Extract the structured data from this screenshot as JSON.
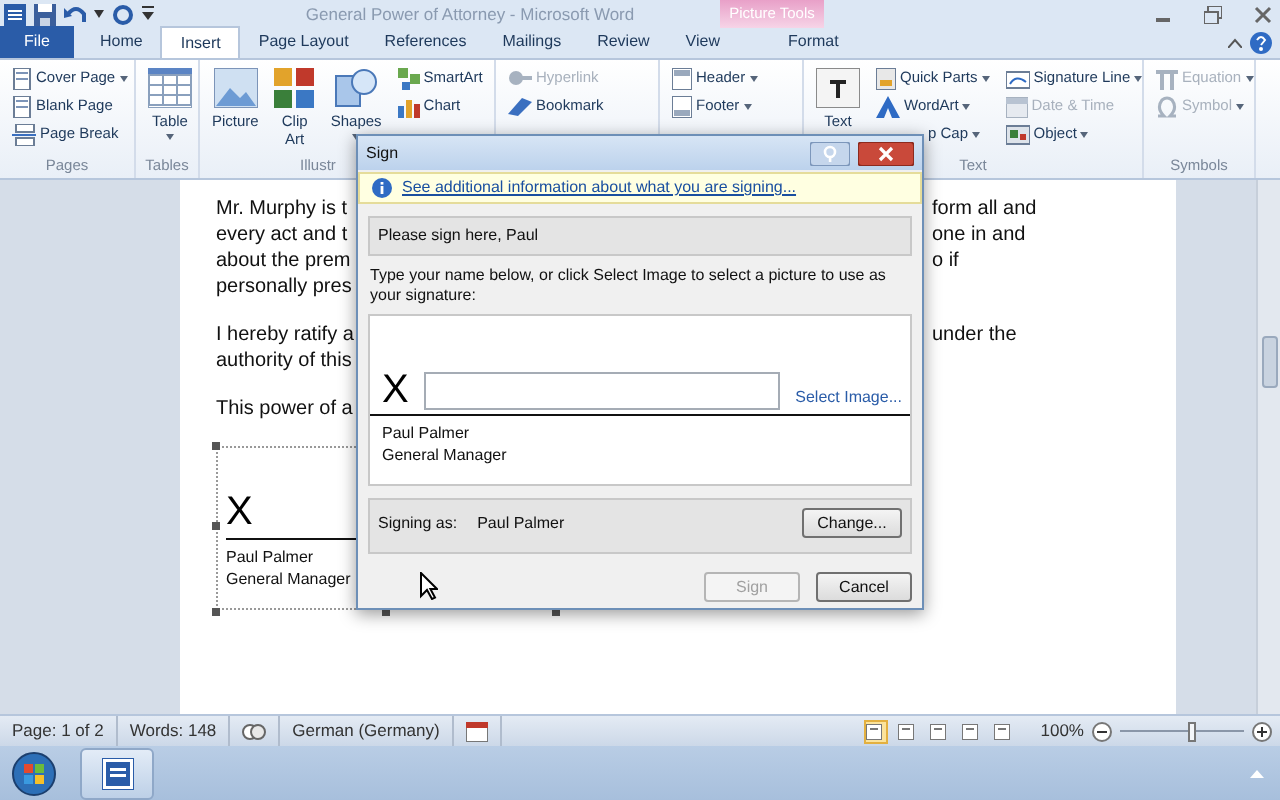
{
  "window": {
    "title": "General Power of Attorney - Microsoft Word",
    "contextual_tab": "Picture Tools"
  },
  "tabs": [
    {
      "label": "File",
      "kind": "file",
      "selected": false
    },
    {
      "label": "Home",
      "kind": "normal",
      "selected": false
    },
    {
      "label": "Insert",
      "kind": "normal",
      "selected": true
    },
    {
      "label": "Page Layout",
      "kind": "normal",
      "selected": false
    },
    {
      "label": "References",
      "kind": "normal",
      "selected": false
    },
    {
      "label": "Mailings",
      "kind": "normal",
      "selected": false
    },
    {
      "label": "Review",
      "kind": "normal",
      "selected": false
    },
    {
      "label": "View",
      "kind": "normal",
      "selected": false
    },
    {
      "label": "Format",
      "kind": "contextual",
      "selected": false
    }
  ],
  "ribbon": {
    "groups": [
      {
        "label": "Pages",
        "items": [
          {
            "label": "Cover Page",
            "kind": "small",
            "dropdown": true,
            "disabled": false
          },
          {
            "label": "Blank Page",
            "kind": "small",
            "dropdown": false,
            "disabled": false
          },
          {
            "label": "Page Break",
            "kind": "small",
            "dropdown": false,
            "disabled": false
          }
        ]
      },
      {
        "label": "Tables",
        "items": [
          {
            "label": "Table",
            "kind": "large",
            "dropdown": true,
            "disabled": false
          }
        ]
      },
      {
        "label": "Illustr",
        "items": [
          {
            "label": "Picture",
            "kind": "large",
            "dropdown": false,
            "disabled": false
          },
          {
            "label": "Clip Art",
            "kind": "large",
            "dropdown": false,
            "disabled": false
          },
          {
            "label": "Shapes",
            "kind": "large",
            "dropdown": true,
            "disabled": false
          },
          {
            "label": "SmartArt",
            "kind": "small",
            "dropdown": false,
            "disabled": false
          },
          {
            "label": "Chart",
            "kind": "small",
            "dropdown": false,
            "disabled": false
          }
        ]
      },
      {
        "items": [
          {
            "label": "Hyperlink",
            "kind": "small",
            "dropdown": false,
            "disabled": true
          },
          {
            "label": "Bookmark",
            "kind": "small",
            "dropdown": false,
            "disabled": false
          }
        ]
      },
      {
        "items": [
          {
            "label": "Header",
            "kind": "small",
            "dropdown": true,
            "disabled": false
          },
          {
            "label": "Footer",
            "kind": "small",
            "dropdown": true,
            "disabled": false
          }
        ]
      },
      {
        "label": "Text",
        "items": [
          {
            "label": "Text",
            "kind": "large",
            "dropdown": false,
            "disabled": false
          },
          {
            "label": "Quick Parts",
            "kind": "small",
            "dropdown": true,
            "disabled": false
          },
          {
            "label": "WordArt",
            "kind": "small",
            "dropdown": true,
            "disabled": false
          },
          {
            "label": "p Cap",
            "kind": "small",
            "dropdown": true,
            "disabled": false
          },
          {
            "label": "Signature Line",
            "kind": "small",
            "dropdown": true,
            "disabled": false
          },
          {
            "label": "Date & Time",
            "kind": "small",
            "dropdown": false,
            "disabled": true
          },
          {
            "label": "Object",
            "kind": "small",
            "dropdown": true,
            "disabled": false
          }
        ]
      },
      {
        "label": "Symbols",
        "items": [
          {
            "label": "Equation",
            "kind": "small",
            "dropdown": true,
            "disabled": true
          },
          {
            "label": "Symbol",
            "kind": "small",
            "dropdown": true,
            "disabled": true
          }
        ]
      }
    ]
  },
  "document": {
    "paragraphs": [
      {
        "lines": [
          {
            "left": "Mr. Murphy is t",
            "right": "form all and"
          },
          {
            "left": "every act and t",
            "right": "one in and"
          },
          {
            "left": "about the prem",
            "right": "o if"
          },
          {
            "left": "personally pres"
          }
        ]
      },
      {
        "lines": [
          {
            "left": "I hereby ratify a",
            "right": "under the"
          },
          {
            "left": "authority of this"
          }
        ]
      },
      {
        "lines": [
          {
            "left": "This power of a"
          }
        ]
      }
    ],
    "signature_line": {
      "mark": "X",
      "name": "Paul Palmer",
      "title": "General Manager"
    }
  },
  "dialog": {
    "title": "Sign",
    "info_link": "See additional information about what you are signing...",
    "instructions": "Please sign here, Paul",
    "prompt": "Type your name below, or click Select Image to select a picture to use as your signature:",
    "mark": "X",
    "select_image": "Select Image...",
    "signer_name": "Paul Palmer",
    "signer_title": "General Manager",
    "signing_as_label": "Signing as:",
    "signing_as": "Paul Palmer",
    "buttons": [
      {
        "label": "Change...",
        "kind": "change",
        "disabled": false
      },
      {
        "label": "Sign",
        "kind": "footer",
        "disabled": true
      },
      {
        "label": "Cancel",
        "kind": "footer",
        "disabled": false
      }
    ]
  },
  "status_bar": {
    "page": "Page: 1 of 2",
    "words": "Words: 148",
    "language": "German (Germany)",
    "views": [
      {
        "selected": true
      },
      {
        "selected": false
      },
      {
        "selected": false
      },
      {
        "selected": false
      },
      {
        "selected": false
      }
    ],
    "zoom": "100%",
    "zoom_slider": {
      "level": 0.58
    }
  }
}
